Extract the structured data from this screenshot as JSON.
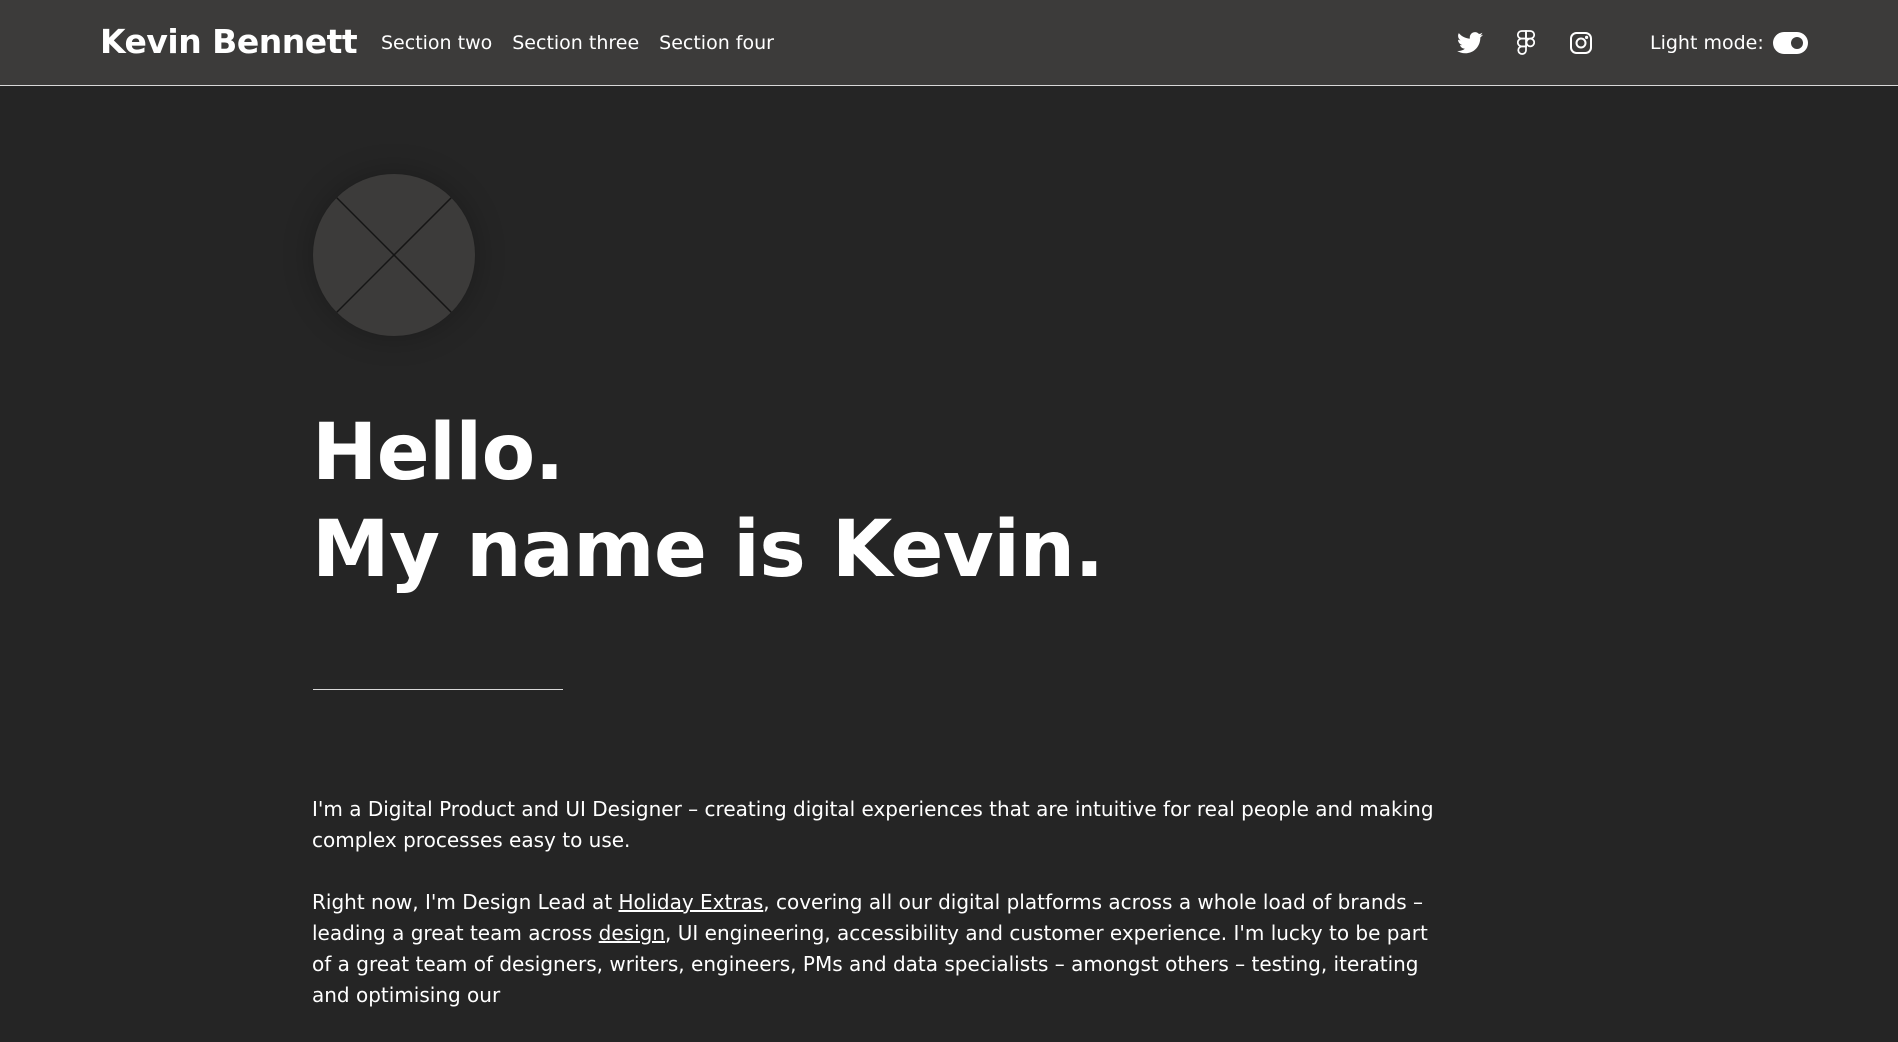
{
  "header": {
    "brand": "Kevin Bennett",
    "nav": [
      {
        "label": "Section two"
      },
      {
        "label": "Section three"
      },
      {
        "label": "Section four"
      }
    ],
    "social": [
      {
        "icon": "twitter-icon"
      },
      {
        "icon": "figma-icon"
      },
      {
        "icon": "instagram-icon"
      }
    ],
    "mode_label": "Light mode:",
    "mode_toggle_state": "on"
  },
  "hero": {
    "avatar_icon": "placeholder-image-icon",
    "line1": "Hello.",
    "line2": "My name is Kevin."
  },
  "bio": {
    "p1": "I'm a Digital Product and UI Designer – creating digital experiences that are intuitive for real people and making complex processes easy to use.",
    "p2": {
      "before_link1": "Right now, I'm Design Lead at ",
      "link1": "Holiday Extras",
      "between": ", covering all our digital platforms across a whole load of brands – leading a great team across ",
      "link2": "design",
      "after": ", UI engineering, accessibility and customer experience. I'm lucky to be part of a great team of designers, writers, engineers, PMs and data specialists – amongst others – testing, iterating and optimising our"
    }
  },
  "colors": {
    "page_background": "#252525",
    "header_background": "#3c3b3a",
    "text": "#ffffff",
    "divider": "#d8d8d8"
  }
}
